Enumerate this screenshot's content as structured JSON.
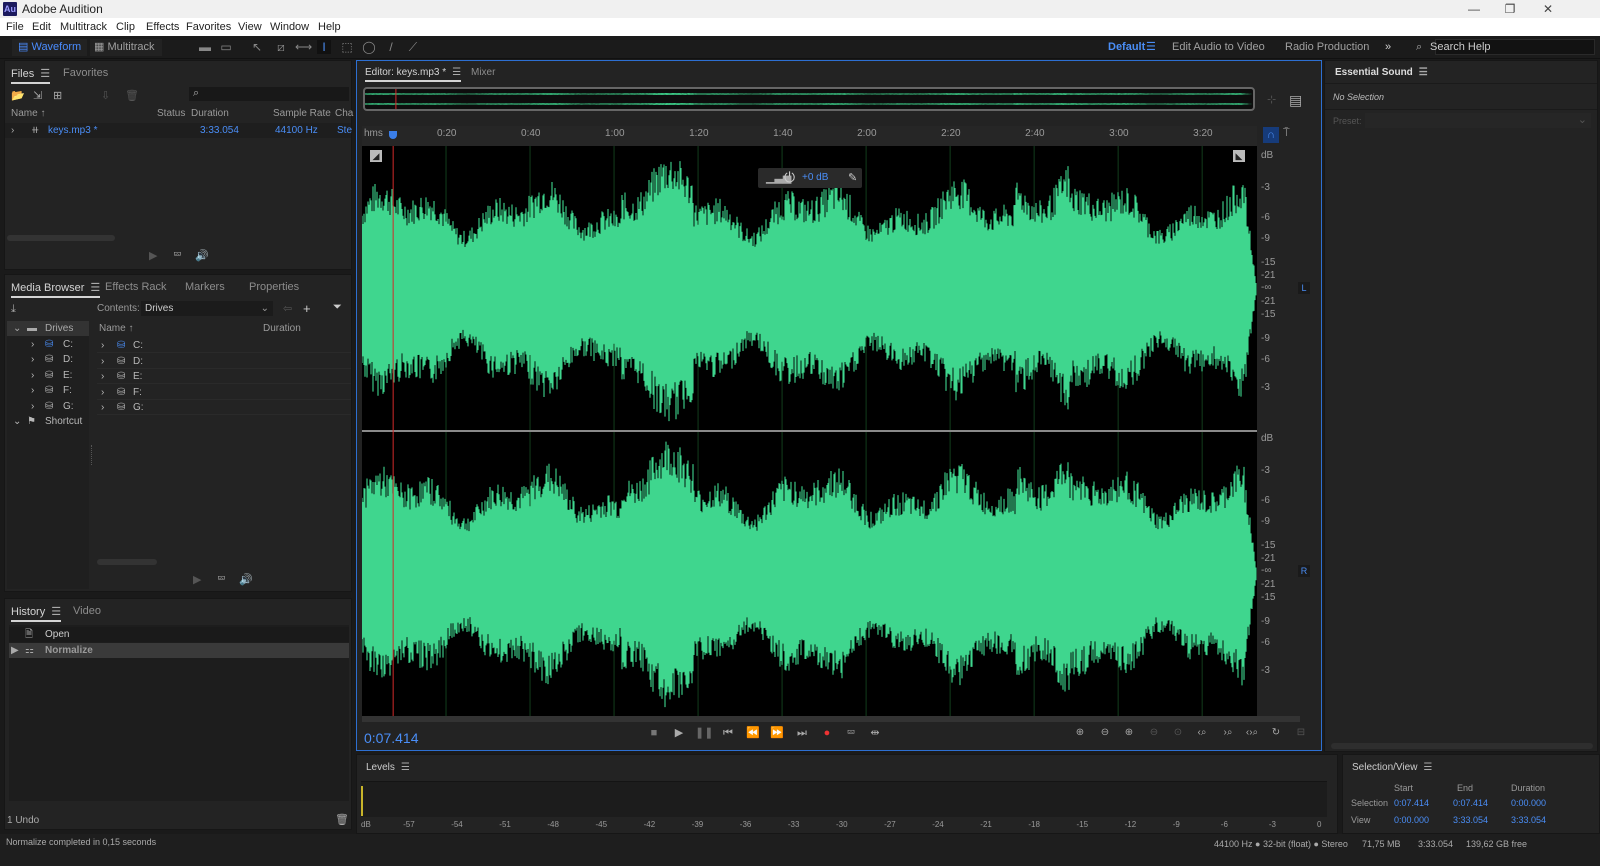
{
  "app": {
    "title": "Adobe Audition",
    "logo": "Au"
  },
  "window_controls": {
    "minimize": "—",
    "maximize": "❐",
    "close": "✕"
  },
  "menu": [
    "File",
    "Edit",
    "Multitrack",
    "Clip",
    "Effects",
    "Favorites",
    "View",
    "Window",
    "Help"
  ],
  "toolbar": {
    "waveform_label": "Waveform",
    "multitrack_label": "Multitrack",
    "workspaces": {
      "active": "Default",
      "others": [
        "Edit Audio to Video",
        "Radio Production"
      ]
    },
    "more": "»",
    "search_placeholder": "Search Help"
  },
  "files_panel": {
    "tabs": [
      "Files",
      "Favorites"
    ],
    "columns": [
      "Name ↑",
      "Status",
      "Duration",
      "Sample Rate",
      "Cha"
    ],
    "rows": [
      {
        "name": "keys.mp3 *",
        "status": "",
        "duration": "3:33.054",
        "sample_rate": "44100 Hz",
        "channels": "Ste"
      }
    ]
  },
  "media_browser": {
    "tabs": [
      "Media Browser",
      "Effects Rack",
      "Markers",
      "Properties"
    ],
    "contents_label": "Contents:",
    "contents_value": "Drives",
    "tree": [
      {
        "label": "Drives",
        "expanded": true
      },
      {
        "label": "C:"
      },
      {
        "label": "D:"
      },
      {
        "label": "E:"
      },
      {
        "label": "F:"
      },
      {
        "label": "G:"
      },
      {
        "label": "Shortcut",
        "expanded": true
      }
    ],
    "columns": [
      "Name ↑",
      "Duration"
    ],
    "items": [
      "C:",
      "D:",
      "E:",
      "F:",
      "G:"
    ]
  },
  "history_panel": {
    "tabs": [
      "History",
      "Video"
    ],
    "items": [
      {
        "label": "Open",
        "selected": false
      },
      {
        "label": "Normalize",
        "selected": true
      }
    ],
    "undo_count": "1 Undo"
  },
  "editor": {
    "tabs": [
      "Editor: keys.mp3 *",
      "Mixer"
    ],
    "time_ruler": [
      "hms",
      "0:20",
      "0:40",
      "1:00",
      "1:20",
      "1:40",
      "2:00",
      "2:20",
      "2:40",
      "3:00",
      "3:20"
    ],
    "db_scale": [
      "dB",
      "-3",
      "-6",
      "-9",
      "-15",
      "-21",
      "-∞",
      "-21",
      "-15",
      "-9",
      "-6",
      "-3"
    ],
    "channels": [
      "L",
      "R"
    ],
    "hud_gain": "+0 dB",
    "current_time": "0:07.414",
    "playhead_seconds": 7.414,
    "total_duration_seconds": 213.054,
    "waveform_color": "#3fd68e",
    "playhead_color": "#d22a2a"
  },
  "essential_sound": {
    "title": "Essential Sound",
    "status": "No Selection",
    "preset_label": "Preset:"
  },
  "levels": {
    "title": "Levels",
    "scale": [
      "dB",
      "-57",
      "-54",
      "-51",
      "-48",
      "-45",
      "-42",
      "-39",
      "-36",
      "-33",
      "-30",
      "-27",
      "-24",
      "-21",
      "-18",
      "-15",
      "-12",
      "-9",
      "-6",
      "-3",
      "0"
    ]
  },
  "selection_view": {
    "title": "Selection/View",
    "columns": [
      "Start",
      "End",
      "Duration"
    ],
    "rows": [
      {
        "label": "Selection",
        "start": "0:07.414",
        "end": "0:07.414",
        "duration": "0:00.000"
      },
      {
        "label": "View",
        "start": "0:00.000",
        "end": "3:33.054",
        "duration": "3:33.054"
      }
    ]
  },
  "status_bar": {
    "message": "Normalize completed in 0,15 seconds",
    "format": "44100 Hz ● 32-bit (float) ● Stereo",
    "size": "71,75 MB",
    "duration": "3:33.054",
    "free": "139,62 GB free"
  }
}
